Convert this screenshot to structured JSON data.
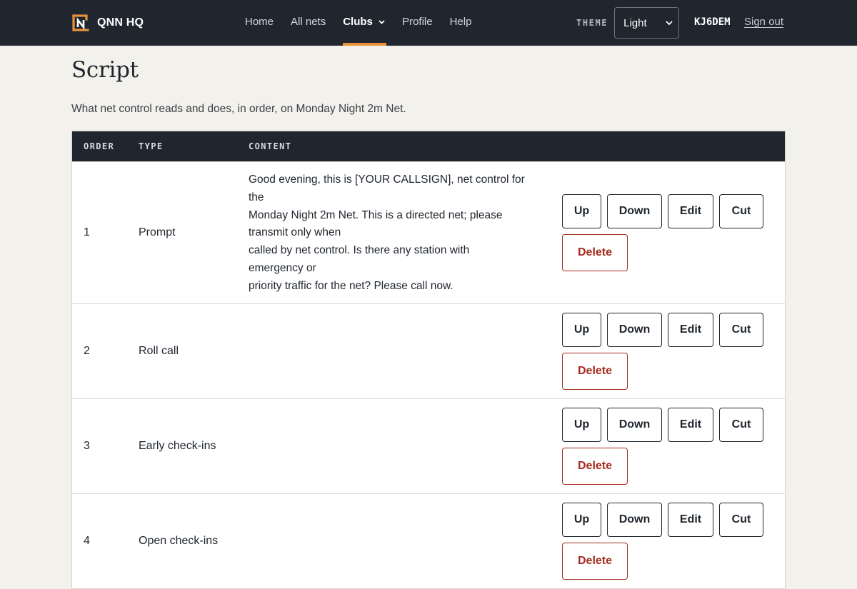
{
  "header": {
    "brand": "QNN HQ",
    "nav": [
      {
        "label": "Home",
        "active": false
      },
      {
        "label": "All nets",
        "active": false
      },
      {
        "label": "Clubs",
        "active": true,
        "has_dropdown": true
      },
      {
        "label": "Profile",
        "active": false
      },
      {
        "label": "Help",
        "active": false
      }
    ],
    "theme_label": "THEME",
    "theme_value": "Light",
    "callsign": "KJ6DEM",
    "sign_out": "Sign out",
    "accent_color": "#e8913a",
    "bar_color": "#20262e"
  },
  "page": {
    "title": "Script",
    "subtitle": "What net control reads and does, in order, on Monday Night 2m Net."
  },
  "table": {
    "columns": [
      "ORDER",
      "TYPE",
      "CONTENT"
    ],
    "rows": [
      {
        "order": "1",
        "type": "Prompt",
        "content_lines": [
          "Good evening, this is [YOUR CALLSIGN], net control for",
          "the",
          "Monday Night 2m Net. This is a directed net; please",
          "transmit only when",
          "called by net control. Is there any station with",
          "emergency or",
          "priority traffic for the net? Please call now."
        ]
      },
      {
        "order": "2",
        "type": "Roll call",
        "content_lines": []
      },
      {
        "order": "3",
        "type": "Early check-ins",
        "content_lines": []
      },
      {
        "order": "4",
        "type": "Open check-ins",
        "content_lines": []
      }
    ],
    "row_actions": {
      "up": "Up",
      "down": "Down",
      "edit": "Edit",
      "cut": "Cut",
      "delete": "Delete"
    },
    "delete_color": "#a52b1f"
  }
}
